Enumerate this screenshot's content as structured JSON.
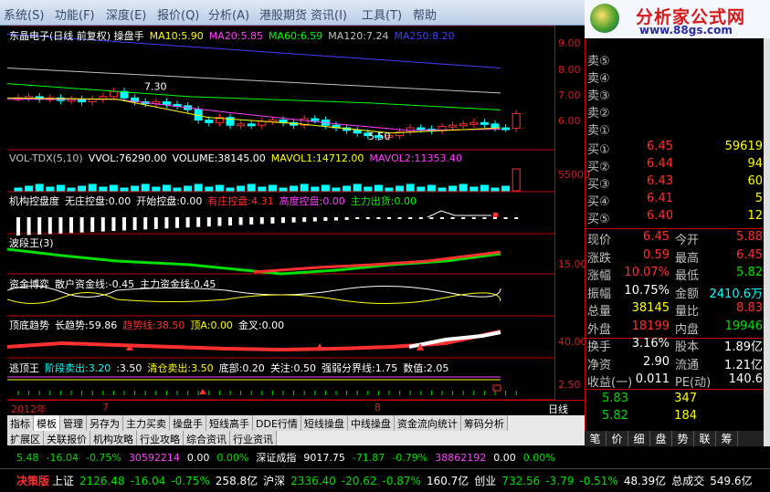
{
  "menu": [
    "系统(S)",
    "功能(F)",
    "深度(E)",
    "报价(Q)",
    "分析(A)",
    "港股期货",
    "资讯(I)",
    "工具(T)",
    "帮助"
  ],
  "brand": {
    "title": "分析家公式网",
    "url": "www.88gs.com"
  },
  "titles": {
    "main": [
      {
        "t": "东晶电子(日线 前复权) 操盘手",
        "c": "#ffffff"
      },
      {
        "t": "MA10:5.90",
        "c": "#ffff00"
      },
      {
        "t": "MA20:5.85",
        "c": "#ff40ff"
      },
      {
        "t": "MA60:6.59",
        "c": "#00ff00"
      },
      {
        "t": "MA120:7.24",
        "c": "#c0c0c0"
      },
      {
        "t": "MA250:8.20",
        "c": "#4040ff"
      }
    ],
    "vol": [
      {
        "t": "VOL-TDX(5,10)",
        "c": "#c0c0c0"
      },
      {
        "t": "VVOL:76290.00",
        "c": "#ffffff"
      },
      {
        "t": "VOLUME:38145.00",
        "c": "#ffffff"
      },
      {
        "t": "MAVOL1:14712.00",
        "c": "#ffff00"
      },
      {
        "t": "MAVOL2:11353.40",
        "c": "#ff40ff"
      }
    ],
    "inst": [
      {
        "t": "机构控盘度",
        "c": "#ffffff"
      },
      {
        "t": "无庄控盘:0.00",
        "c": "#ffffff"
      },
      {
        "t": "开始控盘:0.00",
        "c": "#ffffff"
      },
      {
        "t": "有庄控盘:4.31",
        "c": "#ff3030"
      },
      {
        "t": "高度控盘:0.00",
        "c": "#ff40ff"
      },
      {
        "t": "主力出货:0.00",
        "c": "#00ff00"
      }
    ],
    "wave": [
      {
        "t": "波段王(3)",
        "c": "#ffffff"
      }
    ],
    "fund": [
      {
        "t": "资金博弈",
        "c": "#ffffff"
      },
      {
        "t": "散户资金线:-0.45",
        "c": "#ffffff"
      },
      {
        "t": "主力资金线:0.45",
        "c": "#ffffff"
      }
    ],
    "top": [
      {
        "t": "顶底趋势",
        "c": "#ffffff"
      },
      {
        "t": "长趋势:59.86",
        "c": "#ffffff"
      },
      {
        "t": "趋势线:38.50",
        "c": "#ff3030"
      },
      {
        "t": "顶A:0.00",
        "c": "#ffff00"
      },
      {
        "t": "金叉:0.00",
        "c": "#ffffff"
      }
    ],
    "escape": [
      {
        "t": "逃顶王",
        "c": "#ffffff"
      },
      {
        "t": "阶段卖出:3.20",
        "c": "#00ffff"
      },
      {
        "t": ":3.50",
        "c": "#ffffff"
      },
      {
        "t": "清仓卖出:3.50",
        "c": "#ffff00"
      },
      {
        "t": "底部:0.20",
        "c": "#ffffff"
      },
      {
        "t": "关注:0.50",
        "c": "#ffffff"
      },
      {
        "t": "强弱分界线:1.75",
        "c": "#ffffff"
      },
      {
        "t": "数值:2.05",
        "c": "#ffffff"
      }
    ]
  },
  "axis": {
    "main": [
      "9.00",
      "8.00",
      "7.00",
      "6.00"
    ],
    "vol": "55000",
    "wave": "15.00",
    "top": "40.00",
    "escape": "2.50"
  },
  "annot": {
    "high": "7.30",
    "low": "5.50"
  },
  "xaxis": {
    "year": "2012年",
    "m7": "7",
    "m8": "8",
    "label": "日线"
  },
  "tabs": [
    "指标",
    "模板",
    "管理",
    "另存为",
    "主力买卖",
    "操盘手",
    "短线高手",
    "DDE行情",
    "短线操盘",
    "中线操盘",
    "资金流向统计",
    "筹码分析"
  ],
  "tabs2": [
    "扩展区",
    "关联报价",
    "机构攻略",
    "行业攻略",
    "综合资讯",
    "行业资讯"
  ],
  "panel": {
    "sells": [
      "卖⑤",
      "卖④",
      "卖③",
      "卖②",
      "卖①"
    ],
    "buys": [
      {
        "l": "买①",
        "p": "6.45",
        "v": "59619"
      },
      {
        "l": "买②",
        "p": "6.44",
        "v": "94"
      },
      {
        "l": "买③",
        "p": "6.43",
        "v": "60"
      },
      {
        "l": "买④",
        "p": "6.41",
        "v": "5"
      },
      {
        "l": "买⑤",
        "p": "6.40",
        "v": "12"
      }
    ],
    "stats": [
      {
        "l": "现价",
        "v": "6.45",
        "vc": "red",
        "l2": "今开",
        "v2": "5.88",
        "v2c": "red"
      },
      {
        "l": "涨跌",
        "v": "0.59",
        "vc": "red",
        "l2": "最高",
        "v2": "6.45",
        "v2c": "red"
      },
      {
        "l": "涨幅",
        "v": "10.07%",
        "vc": "red",
        "l2": "最低",
        "v2": "5.82",
        "v2c": "green"
      },
      {
        "l": "振幅",
        "v": "10.75%",
        "vc": "white",
        "l2": "金额",
        "v2": "2410.6万",
        "v2c": "cyan"
      },
      {
        "l": "总量",
        "v": "38145",
        "vc": "yellow",
        "l2": "量比",
        "v2": "8.83",
        "v2c": "red"
      },
      {
        "l": "外盘",
        "v": "18199",
        "vc": "red",
        "l2": "内盘",
        "v2": "19946",
        "v2c": "green"
      },
      {
        "l": "换手",
        "v": "3.16%",
        "vc": "white",
        "l2": "股本",
        "v2": "1.89亿",
        "v2c": "white"
      },
      {
        "l": "净资",
        "v": "2.90",
        "vc": "white",
        "l2": "流通",
        "v2": "1.21亿",
        "v2c": "white"
      },
      {
        "l": "收益(一)",
        "v": "0.011",
        "vc": "white",
        "l2": "PE(动)",
        "v2": "140.6",
        "v2c": "white"
      }
    ],
    "ticks": [
      {
        "p": "5.83",
        "v": "347"
      },
      {
        "p": "5.82",
        "v": "184"
      }
    ]
  },
  "btabs": [
    "笔",
    "价",
    "细",
    "盘",
    "势",
    "联",
    "筹"
  ],
  "ticker": [
    {
      "t": "5.48",
      "c": "green"
    },
    {
      "t": "-16.04",
      "c": "green"
    },
    {
      "t": "-0.75%",
      "c": "green"
    },
    {
      "t": "30592214",
      "c": "magenta"
    },
    {
      "t": "0.00",
      "c": "white"
    },
    {
      "t": "0.00%",
      "c": "green"
    },
    {
      "t": "深证成指",
      "c": "white"
    },
    {
      "t": "9017.75",
      "c": "white"
    },
    {
      "t": "-71.87",
      "c": "green"
    },
    {
      "t": "-0.79%",
      "c": "green"
    },
    {
      "t": "38862192",
      "c": "magenta"
    },
    {
      "t": "0.00",
      "c": "white"
    },
    {
      "t": "0.00%",
      "c": "green"
    }
  ],
  "status": [
    {
      "t": "决策版",
      "c": "red"
    },
    {
      "t": "上证",
      "c": "white"
    },
    {
      "t": "2126.48",
      "c": "green"
    },
    {
      "t": "-16.04",
      "c": "green"
    },
    {
      "t": "-0.75%",
      "c": "green"
    },
    {
      "t": "258.8亿",
      "c": "white"
    },
    {
      "t": "沪深",
      "c": "white"
    },
    {
      "t": "2336.40",
      "c": "green"
    },
    {
      "t": "-20.62",
      "c": "green"
    },
    {
      "t": "-0.87%",
      "c": "green"
    },
    {
      "t": "160.7亿",
      "c": "white"
    },
    {
      "t": "创业",
      "c": "white"
    },
    {
      "t": "732.56",
      "c": "green"
    },
    {
      "t": "-3.79",
      "c": "green"
    },
    {
      "t": "-0.51%",
      "c": "green"
    },
    {
      "t": "48.39亿",
      "c": "white"
    },
    {
      "t": "总成交",
      "c": "white"
    },
    {
      "t": "549.6亿",
      "c": "white"
    }
  ],
  "colors": {
    "up": "#ff3030",
    "down": "#00e000",
    "grid": "#c00000"
  }
}
